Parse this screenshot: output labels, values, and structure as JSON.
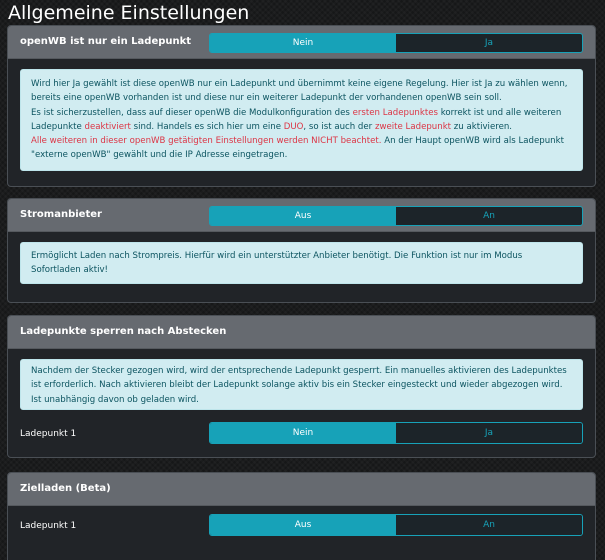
{
  "page": {
    "title": "Allgemeine Einstellungen"
  },
  "cards": {
    "openwb_only": {
      "title": "openWB ist nur ein Ladepunkt",
      "toggle": {
        "left": "Nein",
        "right": "Ja",
        "selected": "Nein"
      },
      "info": {
        "t1": "Wird hier Ja gewählt ist diese openWB nur ein Ladepunkt und übernimmt keine eigene Regelung. Hier ist Ja zu wählen wenn, bereits eine openWB vorhanden ist und diese nur ein weiterer Ladepunkt der vorhandenen openWB sein soll.",
        "t2": "Es ist sicherzustellen, dass auf dieser openWB die Modulkonfiguration des ",
        "r1": "ersten Ladepunktes",
        "t3": " korrekt ist und alle weiteren Ladepunkte ",
        "r2": "deaktiviert",
        "t4": " sind. Handels es sich hier um eine ",
        "r3": "DUO",
        "t5": ", so ist auch der ",
        "r4": "zweite Ladepunkt",
        "t6": " zu aktivieren.",
        "r5": "Alle weiteren in dieser openWB getätigten Einstellungen werden NICHT beachtet.",
        "t7": " An der Haupt openWB wird als Ladepunkt \"externe openWB\" gewählt und die IP Adresse eingetragen."
      }
    },
    "stromanbieter": {
      "title": "Stromanbieter",
      "toggle": {
        "left": "Aus",
        "right": "An",
        "selected": "Aus"
      },
      "info": "Ermöglicht Laden nach Strompreis. Hierfür wird ein unterstützter Anbieter benötigt. Die Funktion ist nur im Modus Sofortladen aktiv!"
    },
    "sperren": {
      "title": "Ladepunkte sperren nach Abstecken",
      "info": "Nachdem der Stecker gezogen wird, wird der entsprechende Ladepunkt gesperrt. Ein manuelles aktivieren des Ladepunktes ist erforderlich. Nach aktivieren bleibt der Ladepunkt solange aktiv bis ein Stecker eingesteckt und wieder abgezogen wird. Ist unabhängig davon ob geladen wird.",
      "row_label": "Ladepunkt 1",
      "toggle": {
        "left": "Nein",
        "right": "Ja",
        "selected": "Nein"
      }
    },
    "zielladen": {
      "title": "Zielladen (Beta)",
      "row_label": "Ladepunkt 1",
      "toggle": {
        "left": "Aus",
        "right": "An",
        "selected": "Aus"
      }
    }
  },
  "colors": {
    "accent": "#17a2b8",
    "info_bg": "#d1ecf1",
    "info_text": "#0c5460",
    "warn_red": "#dc3545",
    "header_bg": "#666a70"
  }
}
